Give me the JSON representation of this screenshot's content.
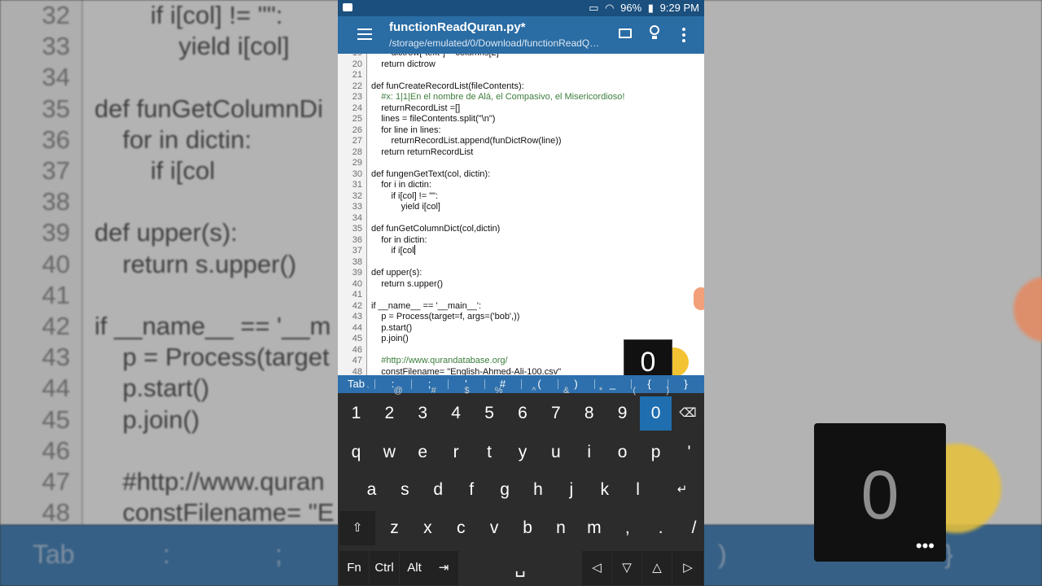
{
  "status_bar": {
    "battery": "96%",
    "time": "9:29 PM"
  },
  "app_bar": {
    "title": "functionReadQuran.py*",
    "path": "/storage/emulated/0/Download/functionReadQ…"
  },
  "editor": {
    "lines": [
      {
        "n": "19",
        "t": "        dictrow[\"text\"] = columns[2]",
        "c": "code"
      },
      {
        "n": "20",
        "t": "    return dictrow",
        "c": "code"
      },
      {
        "n": "21",
        "t": "",
        "c": "code"
      },
      {
        "n": "22",
        "t": "def funCreateRecordList(fileContents):",
        "c": "code"
      },
      {
        "n": "23",
        "t": "    #x: 1|1|En el nombre de Alá, el Compasivo, el Misericordioso!",
        "c": "comment"
      },
      {
        "n": "24",
        "t": "    returnRecordList =[]",
        "c": "code"
      },
      {
        "n": "25",
        "t": "    lines = fileContents.split(\"\\n\")",
        "c": "code"
      },
      {
        "n": "26",
        "t": "    for line in lines:",
        "c": "code"
      },
      {
        "n": "27",
        "t": "        returnRecordList.append(funDictRow(line))",
        "c": "code"
      },
      {
        "n": "28",
        "t": "    return returnRecordList",
        "c": "code"
      },
      {
        "n": "29",
        "t": "",
        "c": "code"
      },
      {
        "n": "30",
        "t": "def fungenGetText(col, dictin):",
        "c": "code"
      },
      {
        "n": "31",
        "t": "    for i in dictin:",
        "c": "code"
      },
      {
        "n": "32",
        "t": "        if i[col] != \"\":",
        "c": "code"
      },
      {
        "n": "33",
        "t": "            yield i[col]",
        "c": "code"
      },
      {
        "n": "34",
        "t": "",
        "c": "code"
      },
      {
        "n": "35",
        "t": "def funGetColumnDict(col,dictin)",
        "c": "code"
      },
      {
        "n": "36",
        "t": "    for in dictin:",
        "c": "code"
      },
      {
        "n": "37",
        "t": "        if i[col",
        "c": "code"
      },
      {
        "n": "38",
        "t": "",
        "c": "code"
      },
      {
        "n": "39",
        "t": "def upper(s):",
        "c": "code"
      },
      {
        "n": "40",
        "t": "    return s.upper()",
        "c": "code"
      },
      {
        "n": "41",
        "t": "",
        "c": "code"
      },
      {
        "n": "42",
        "t": "if __name__ == '__main__':",
        "c": "code"
      },
      {
        "n": "43",
        "t": "    p = Process(target=f, args=('bob',))",
        "c": "code"
      },
      {
        "n": "44",
        "t": "    p.start()",
        "c": "code"
      },
      {
        "n": "45",
        "t": "    p.join()",
        "c": "code"
      },
      {
        "n": "46",
        "t": "",
        "c": "code"
      },
      {
        "n": "47",
        "t": "    #http://www.qurandatabase.org/",
        "c": "comment"
      },
      {
        "n": "48",
        "t": "    constFilename= \"English-Ahmed-Ali-100.csv\"",
        "c": "code"
      }
    ]
  },
  "key_preview": {
    "label": "0",
    "more": "•••"
  },
  "extra_keys": [
    "Tab",
    ":",
    ";",
    "'",
    "#",
    "(",
    ")",
    "_",
    "{",
    "}"
  ],
  "keyboard": {
    "row1": [
      {
        "k": "1",
        "a": "`"
      },
      {
        "k": "2",
        "a": "@"
      },
      {
        "k": "3",
        "a": "#"
      },
      {
        "k": "4",
        "a": "$"
      },
      {
        "k": "5",
        "a": "%"
      },
      {
        "k": "6",
        "a": "^"
      },
      {
        "k": "7",
        "a": "&"
      },
      {
        "k": "8",
        "a": "*"
      },
      {
        "k": "9",
        "a": "("
      },
      {
        "k": "0",
        "a": ")"
      }
    ],
    "row2": [
      "q",
      "w",
      "e",
      "r",
      "t",
      "y",
      "u",
      "i",
      "o",
      "p",
      "'"
    ],
    "row3": [
      "a",
      "s",
      "d",
      "f",
      "g",
      "h",
      "j",
      "k",
      "l"
    ],
    "row4": [
      "z",
      "x",
      "c",
      "v",
      "b",
      "n",
      "m",
      ",",
      ".",
      "/"
    ],
    "row5": [
      "Fn",
      "Ctrl",
      "Alt"
    ],
    "backspace": "⌫",
    "enter": "↵",
    "shift": "⇧",
    "tab": "⇥",
    "space": "␣",
    "arrow_left": "◁",
    "arrow_down": "▽",
    "arrow_up": "△",
    "arrow_right": "▷"
  },
  "background": {
    "lines": [
      {
        "n": "32",
        "t": "        if i[col] != \"\":"
      },
      {
        "n": "33",
        "t": "            yield i[col]"
      },
      {
        "n": "34",
        "t": ""
      },
      {
        "n": "35",
        "t": "def funGetColumnDi"
      },
      {
        "n": "36",
        "t": "    for in dictin:"
      },
      {
        "n": "37",
        "t": "        if i[col"
      },
      {
        "n": "38",
        "t": ""
      },
      {
        "n": "39",
        "t": "def upper(s):"
      },
      {
        "n": "40",
        "t": "    return s.upper()"
      },
      {
        "n": "41",
        "t": ""
      },
      {
        "n": "42",
        "t": "if __name__ == '__m"
      },
      {
        "n": "43",
        "t": "    p = Process(target"
      },
      {
        "n": "44",
        "t": "    p.start()"
      },
      {
        "n": "45",
        "t": "    p.join()"
      },
      {
        "n": "46",
        "t": ""
      },
      {
        "n": "47",
        "t": "    #http://www.quran"
      },
      {
        "n": "48",
        "t": "    constFilename= \"E"
      }
    ],
    "bar_keys": [
      "Tab",
      ":",
      ";"
    ],
    "bubble_label": "0",
    "bubble_more": "•••",
    "right_fragments": [
      ")",
      "}"
    ]
  },
  "colors": {
    "status_bar": "#1a4f7e",
    "app_bar": "#2a6ca4",
    "extra_keys_bar": "#2d70ad",
    "keyboard_bg": "#2c2c2c",
    "selected_key": "#1f6fb0",
    "comment": "#3c7d3c"
  }
}
